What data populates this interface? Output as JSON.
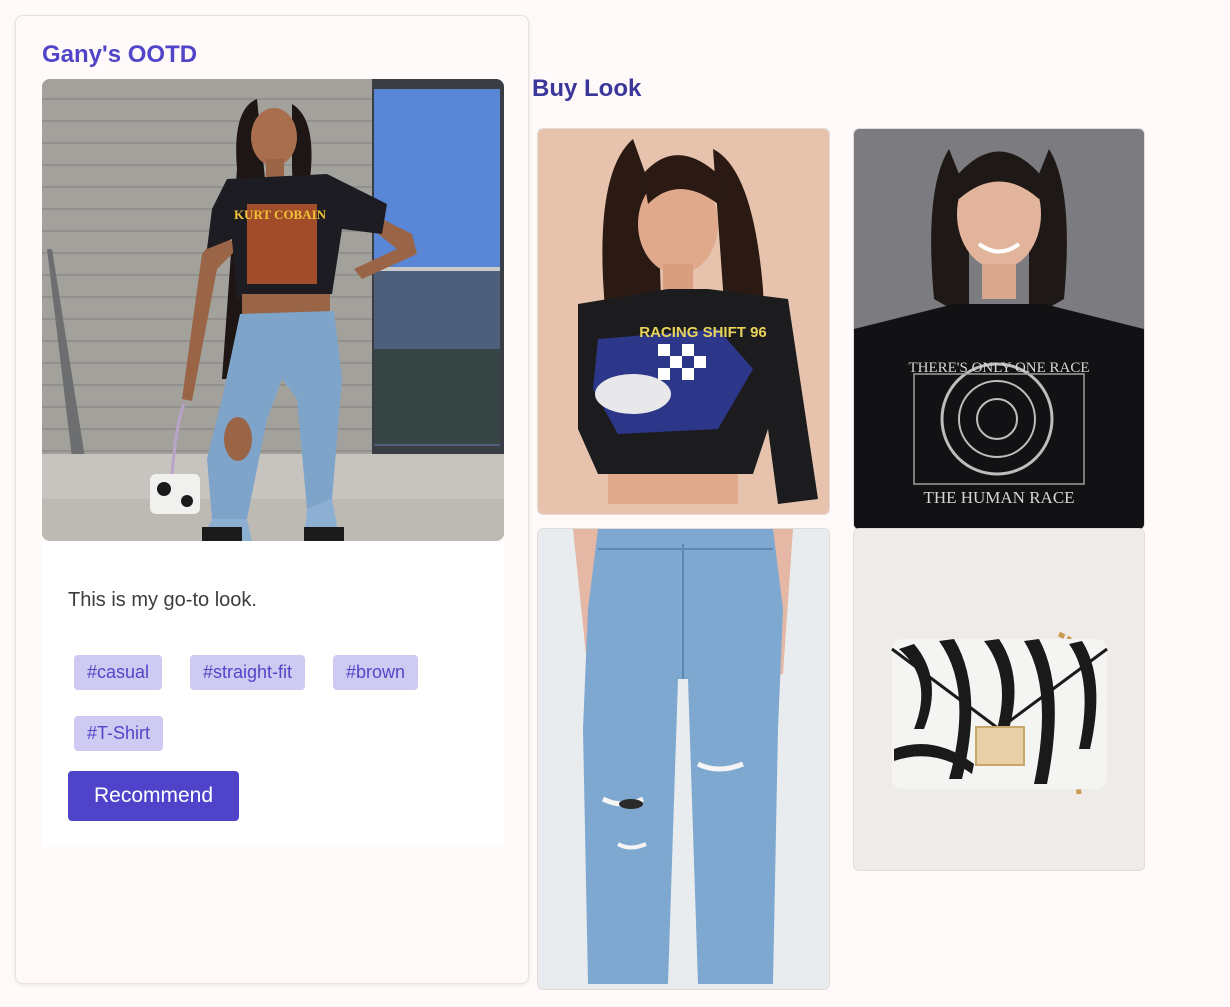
{
  "post": {
    "title": "Gany's OOTD",
    "caption": "This is my go-to look.",
    "tags": [
      "#casual",
      "#straight-fit",
      "#brown",
      "#T-Shirt"
    ],
    "recommend_label": "Recommend",
    "photo_shirt_text": "KURT COBAIN"
  },
  "buy_look": {
    "title": "Buy Look",
    "products": [
      {
        "name": "black-racing-crop-tee",
        "print_text": "RACING SHIFT 96"
      },
      {
        "name": "black-graphic-tee",
        "print_line1": "THERE'S ONLY ONE RACE",
        "print_line2": "THE HUMAN RACE"
      },
      {
        "name": "ripped-straight-jeans"
      },
      {
        "name": "zebra-print-crossbody-bag"
      }
    ]
  },
  "colors": {
    "accent": "#5146c8",
    "tag_bg": "#cfcaf2",
    "button_bg": "#4f44c9",
    "page_bg": "#fffaf9"
  }
}
